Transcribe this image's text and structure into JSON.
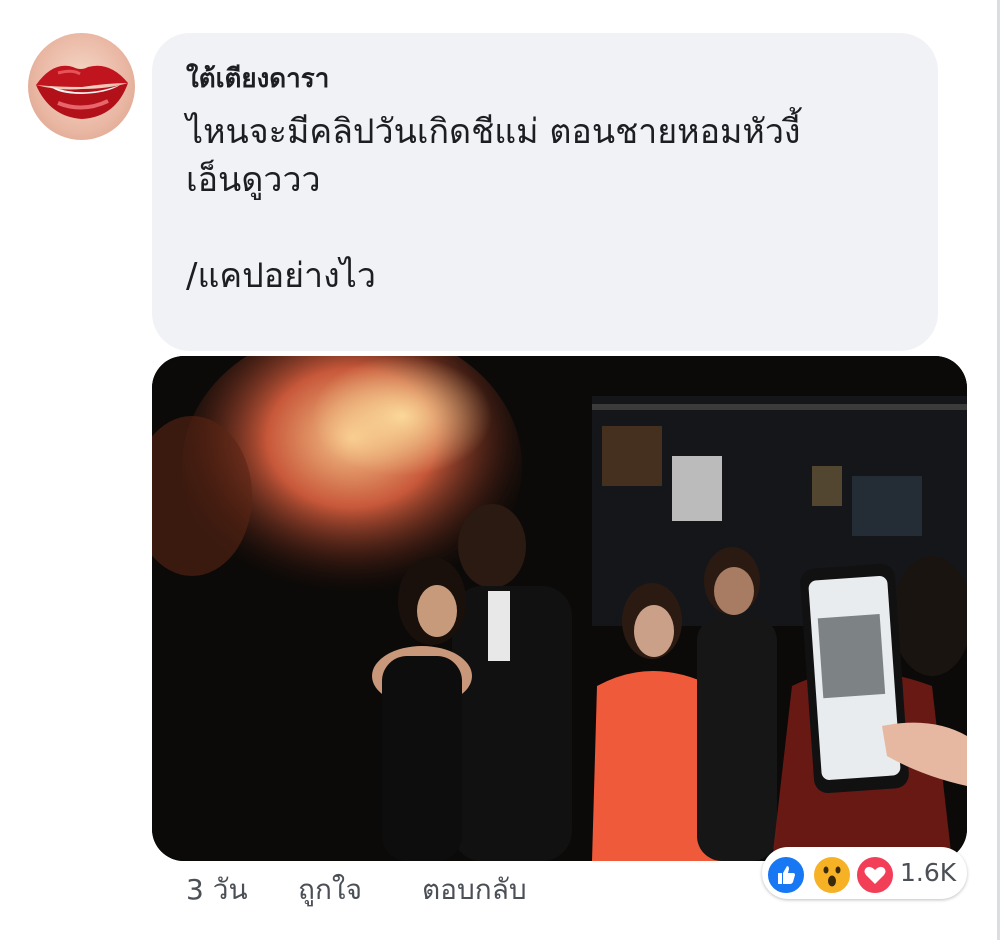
{
  "comment": {
    "author": "ใต้เตียงดารา",
    "text": "ไหนจะมีคลิปวันเกิดชีแม่ ตอนชายหอมหัวงี้\nเอ็นดูววว\n\n/แคปอย่างไว"
  },
  "footer": {
    "time": "3 วัน",
    "like_label": "ถูกใจ",
    "reply_label": "ตอบกลับ"
  },
  "reactions": {
    "icons": [
      "like-icon",
      "wow-icon",
      "love-icon"
    ],
    "count": "1.6K"
  },
  "colors": {
    "bubble": "#f0f2f5",
    "like": "#1877f2",
    "wow": "#f7b125",
    "love": "#f33e58",
    "meta_text": "#4b4f56"
  }
}
